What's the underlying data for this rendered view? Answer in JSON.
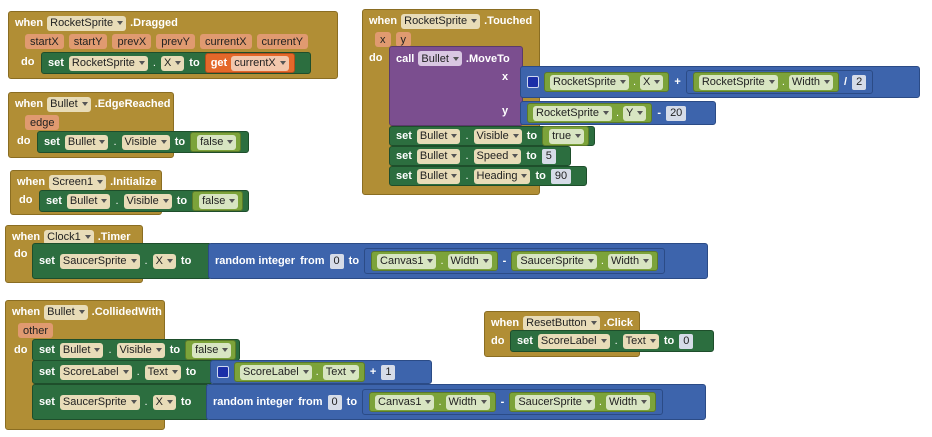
{
  "labels": {
    "when": "when",
    "do": "do",
    "set": "set",
    "to": "to",
    "get": "get",
    "call": "call",
    "random_integer": "random integer",
    "from": "from",
    "plus": "+",
    "minus": "-",
    "divide": "/",
    "dot": "."
  },
  "blocks": {
    "dragged": {
      "component": "RocketSprite",
      "event": ".Dragged",
      "params": [
        "startX",
        "startY",
        "prevX",
        "prevY",
        "currentX",
        "currentY"
      ],
      "set_component": "RocketSprite",
      "set_property": "X",
      "get_var": "currentX"
    },
    "edge": {
      "component": "Bullet",
      "event": ".EdgeReached",
      "params": [
        "edge"
      ],
      "set_component": "Bullet",
      "set_property": "Visible",
      "value": "false"
    },
    "init": {
      "component": "Screen1",
      "event": ".Initialize",
      "set_component": "Bullet",
      "set_property": "Visible",
      "value": "false"
    },
    "timer": {
      "component": "Clock1",
      "event": ".Timer",
      "set_component": "SaucerSprite",
      "set_property": "X",
      "from_value": "0",
      "canvas": "Canvas1",
      "canvas_prop": "Width",
      "sprite": "SaucerSprite",
      "sprite_prop": "Width"
    },
    "collided": {
      "component": "Bullet",
      "event": ".CollidedWith",
      "params": [
        "other"
      ],
      "s1_component": "Bullet",
      "s1_property": "Visible",
      "s1_value": "false",
      "s2_component": "ScoreLabel",
      "s2_property": "Text",
      "s2_getter_component": "ScoreLabel",
      "s2_getter_property": "Text",
      "s2_add": "1",
      "s3_component": "SaucerSprite",
      "s3_property": "X",
      "from_value": "0",
      "canvas": "Canvas1",
      "canvas_prop": "Width",
      "sprite": "SaucerSprite",
      "sprite_prop": "Width"
    },
    "touched": {
      "component": "RocketSprite",
      "event": ".Touched",
      "params": [
        "x",
        "y"
      ],
      "call_component": "Bullet",
      "method": ".MoveTo",
      "arg_x": "x",
      "arg_y": "y",
      "x_getter_component": "RocketSprite",
      "x_getter_property": "X",
      "x_width_component": "RocketSprite",
      "x_width_property": "Width",
      "x_divisor": "2",
      "y_getter_component": "RocketSprite",
      "y_getter_property": "Y",
      "y_offset": "20",
      "s1_component": "Bullet",
      "s1_property": "Visible",
      "s1_value": "true",
      "s2_component": "Bullet",
      "s2_property": "Speed",
      "s2_value": "5",
      "s3_component": "Bullet",
      "s3_property": "Heading",
      "s3_value": "90"
    },
    "reset": {
      "component": "ResetButton",
      "event": ".Click",
      "set_component": "ScoreLabel",
      "set_property": "Text",
      "value": "0"
    }
  }
}
